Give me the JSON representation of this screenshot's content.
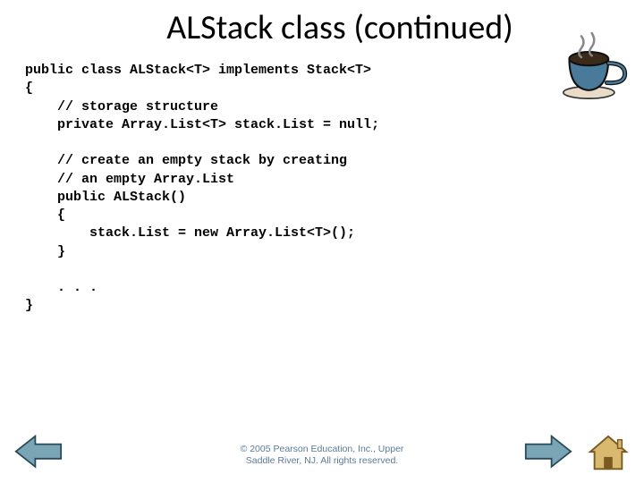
{
  "title": "ALStack class (continued)",
  "code": "public class ALStack<T> implements Stack<T>\n{\n    // storage structure\n    private Array.List<T> stack.List = null;\n\n    // create an empty stack by creating\n    // an empty Array.List\n    public ALStack()\n    {\n        stack.List = new Array.List<T>();\n    }\n\n    . . .\n}",
  "footer_line1": "© 2005 Pearson Education, Inc., Upper",
  "footer_line2": "Saddle River, NJ.  All rights reserved.",
  "icons": {
    "coffee": "coffee-cup-icon",
    "prev": "prev-arrow-icon",
    "next": "next-arrow-icon",
    "home": "home-icon"
  },
  "colors": {
    "arrow_fill": "#7aa5b5",
    "arrow_stroke": "#2a4a58",
    "home_fill": "#d9b86f",
    "home_stroke": "#7a5a20",
    "footer_text": "#5b7a9a"
  }
}
